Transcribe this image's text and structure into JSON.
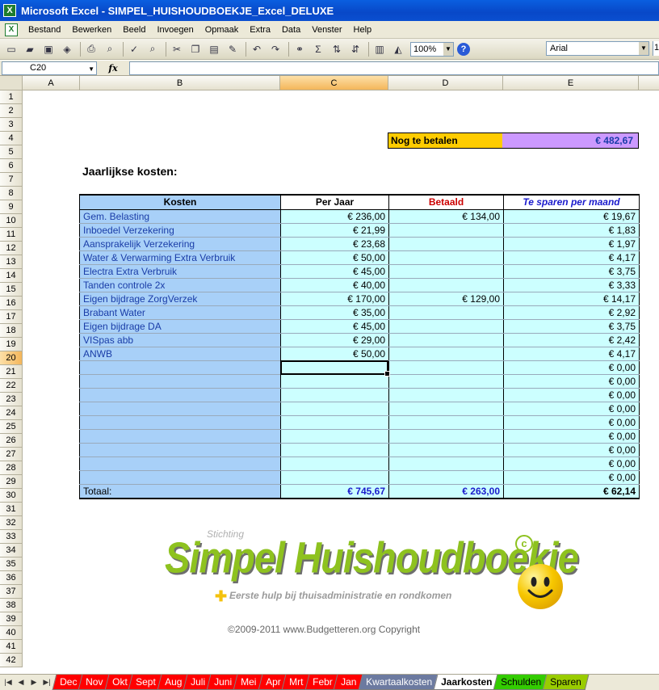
{
  "window": {
    "title": "Microsoft Excel - SIMPEL_HUISHOUDBOEKJE_Excel_DELUXE",
    "app_icon": "excel-icon"
  },
  "menu": [
    "Bestand",
    "Bewerken",
    "Beeld",
    "Invoegen",
    "Opmaak",
    "Extra",
    "Data",
    "Venster",
    "Help"
  ],
  "toolbar": {
    "zoom": "100%",
    "font": "Arial",
    "font_size": "1"
  },
  "formula_bar": {
    "name_box": "C20",
    "fx": "fx",
    "content": ""
  },
  "columns": [
    "A",
    "B",
    "C",
    "D",
    "E"
  ],
  "active_column": "C",
  "rows": [
    "1",
    "2",
    "3",
    "4",
    "5",
    "6",
    "7",
    "8",
    "9",
    "10",
    "11",
    "12",
    "13",
    "14",
    "15",
    "16",
    "17",
    "18",
    "19",
    "20",
    "21",
    "22",
    "23",
    "24",
    "25",
    "26",
    "27",
    "28",
    "29",
    "30",
    "31",
    "32",
    "33",
    "34",
    "35",
    "36",
    "37",
    "38",
    "39",
    "40",
    "41",
    "42"
  ],
  "active_row": "20",
  "summary": {
    "label": "Nog te betalen",
    "value": "€ 482,67"
  },
  "section_title": "Jaarlijkse kosten:",
  "table": {
    "headers": {
      "kosten": "Kosten",
      "per_jaar": "Per Jaar",
      "betaald": "Betaald",
      "sparen": "Te sparen per maand"
    },
    "rows": [
      {
        "kosten": "Gem. Belasting",
        "per_jaar": "€ 236,00",
        "betaald": "€ 134,00",
        "sparen": "€ 19,67"
      },
      {
        "kosten": "Inboedel Verzekering",
        "per_jaar": "€ 21,99",
        "betaald": "",
        "sparen": "€ 1,83"
      },
      {
        "kosten": "Aansprakelijk Verzekering",
        "per_jaar": "€ 23,68",
        "betaald": "",
        "sparen": "€ 1,97"
      },
      {
        "kosten": "Water & Verwarming Extra Verbruik",
        "per_jaar": "€ 50,00",
        "betaald": "",
        "sparen": "€ 4,17"
      },
      {
        "kosten": "Electra Extra Verbruik",
        "per_jaar": "€ 45,00",
        "betaald": "",
        "sparen": "€ 3,75"
      },
      {
        "kosten": "Tanden controle 2x",
        "per_jaar": "€ 40,00",
        "betaald": "",
        "sparen": "€ 3,33"
      },
      {
        "kosten": "Eigen bijdrage ZorgVerzek",
        "per_jaar": "€ 170,00",
        "betaald": "€ 129,00",
        "sparen": "€ 14,17"
      },
      {
        "kosten": "Brabant Water",
        "per_jaar": "€ 35,00",
        "betaald": "",
        "sparen": "€ 2,92"
      },
      {
        "kosten": "Eigen bijdrage DA",
        "per_jaar": "€ 45,00",
        "betaald": "",
        "sparen": "€ 3,75"
      },
      {
        "kosten": "VISpas abb",
        "per_jaar": "€ 29,00",
        "betaald": "",
        "sparen": "€ 2,42"
      },
      {
        "kosten": "ANWB",
        "per_jaar": "€ 50,00",
        "betaald": "",
        "sparen": "€ 4,17"
      },
      {
        "kosten": "",
        "per_jaar": "",
        "betaald": "",
        "sparen": "€ 0,00"
      },
      {
        "kosten": "",
        "per_jaar": "",
        "betaald": "",
        "sparen": "€ 0,00"
      },
      {
        "kosten": "",
        "per_jaar": "",
        "betaald": "",
        "sparen": "€ 0,00"
      },
      {
        "kosten": "",
        "per_jaar": "",
        "betaald": "",
        "sparen": "€ 0,00"
      },
      {
        "kosten": "",
        "per_jaar": "",
        "betaald": "",
        "sparen": "€ 0,00"
      },
      {
        "kosten": "",
        "per_jaar": "",
        "betaald": "",
        "sparen": "€ 0,00"
      },
      {
        "kosten": "",
        "per_jaar": "",
        "betaald": "",
        "sparen": "€ 0,00"
      },
      {
        "kosten": "",
        "per_jaar": "",
        "betaald": "",
        "sparen": "€ 0,00"
      },
      {
        "kosten": "",
        "per_jaar": "",
        "betaald": "",
        "sparen": "€ 0,00"
      }
    ],
    "total": {
      "kosten": "Totaal:",
      "per_jaar": "€ 745,67",
      "betaald": "€ 263,00",
      "sparen": "€ 62,14"
    }
  },
  "logo": {
    "stichting": "Stichting",
    "brand": "Simpel Huishoudboekje",
    "copyright_mark": "c",
    "tagline": "Eerste hulp bij thuisadministratie en rondkomen"
  },
  "footer_copyright": "©2009-2011 www.Budgetteren.org Copyright",
  "sheet_tabs": [
    {
      "label": "Dec",
      "style": "red"
    },
    {
      "label": "Nov",
      "style": "red"
    },
    {
      "label": "Okt",
      "style": "red"
    },
    {
      "label": "Sept",
      "style": "red"
    },
    {
      "label": "Aug",
      "style": "red"
    },
    {
      "label": "Juli",
      "style": "red"
    },
    {
      "label": "Juni",
      "style": "red"
    },
    {
      "label": "Mei",
      "style": "red"
    },
    {
      "label": "Apr",
      "style": "red"
    },
    {
      "label": "Mrt",
      "style": "red"
    },
    {
      "label": "Febr",
      "style": "red"
    },
    {
      "label": "Jan",
      "style": "red"
    },
    {
      "label": "Kwartaalkosten",
      "style": "slate"
    },
    {
      "label": "Jaarkosten",
      "style": "active"
    },
    {
      "label": "Schulden",
      "style": "green1"
    },
    {
      "label": "Sparen",
      "style": "green2"
    }
  ],
  "colors": {
    "title_bar": "#0a4fd0",
    "kosten_col": "#a8d0f8",
    "value_cols": "#ccffff",
    "summary_label": "#ffcc00",
    "summary_value": "#cc99ff",
    "brand": "#8ec21f"
  }
}
